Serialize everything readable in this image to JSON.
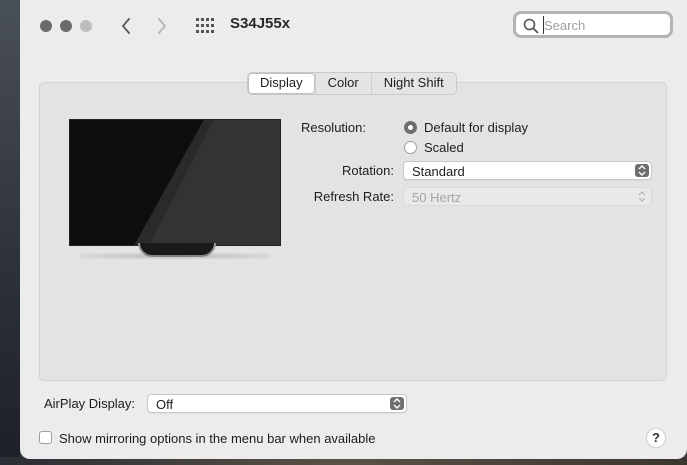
{
  "window": {
    "title": "S34J55x"
  },
  "toolbar": {
    "back_icon": "chevron-left-icon",
    "forward_icon": "chevron-right-icon",
    "grid_icon": "show-all-grid-icon"
  },
  "search": {
    "placeholder": "Search",
    "value": ""
  },
  "tabs": [
    {
      "label": "Display",
      "active": true
    },
    {
      "label": "Color",
      "active": false
    },
    {
      "label": "Night Shift",
      "active": false
    }
  ],
  "display": {
    "resolution_label": "Resolution:",
    "resolution_options": [
      {
        "label": "Default for display",
        "selected": true
      },
      {
        "label": "Scaled",
        "selected": false
      }
    ],
    "rotation_label": "Rotation:",
    "rotation_value": "Standard",
    "refresh_label": "Refresh Rate:",
    "refresh_value": "50 Hertz"
  },
  "airplay": {
    "label": "AirPlay Display:",
    "value": "Off"
  },
  "mirroring": {
    "label": "Show mirroring options in the menu bar when available",
    "checked": false
  },
  "help": {
    "label": "?"
  }
}
